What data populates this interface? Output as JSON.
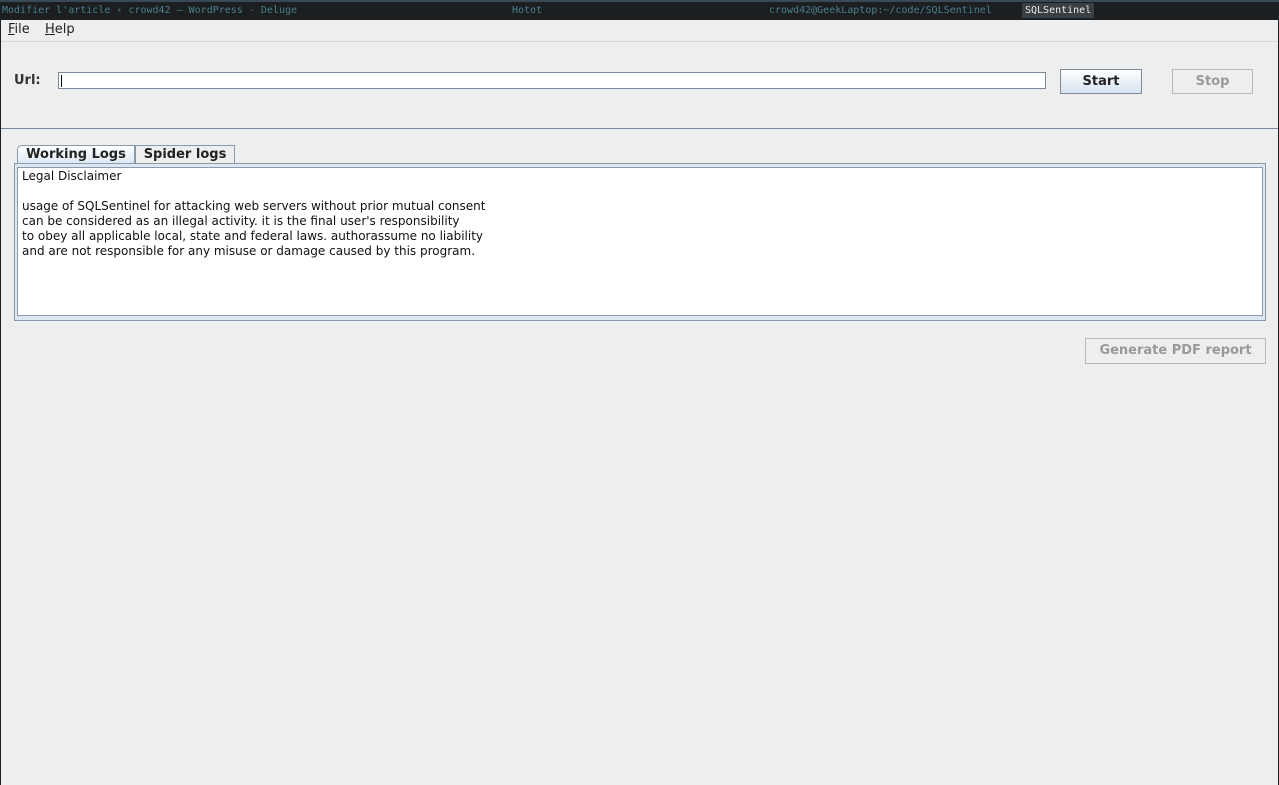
{
  "taskbar": {
    "tasks": [
      {
        "label": "Modifier l'article ‹ crowd42 — WordPress - Deluge"
      },
      {
        "label": "Hotot"
      },
      {
        "label": "crowd42@GeekLaptop:~/code/SQLSentinel"
      },
      {
        "label": "SQLSentinel"
      }
    ]
  },
  "menubar": {
    "items": [
      {
        "mnemonic": "F",
        "rest": "ile"
      },
      {
        "mnemonic": "H",
        "rest": "elp"
      }
    ]
  },
  "url_bar": {
    "label": "Url:",
    "value": "",
    "start_label": "Start",
    "stop_label": "Stop"
  },
  "tabs": [
    {
      "label": "Working Logs",
      "active": true
    },
    {
      "label": "Spider logs",
      "active": false
    }
  ],
  "log": {
    "text": "Legal Disclaimer\n\nusage of SQLSentinel for attacking web servers without prior mutual consent\ncan be considered as an illegal activity. it is the final user's responsibility\nto obey all applicable local, state and federal laws. authorassume no liability\nand are not responsible for any misuse or damage caused by this program."
  },
  "report": {
    "button_label": "Generate PDF report"
  },
  "colors": {
    "taskbar_bg": "#1b1f22",
    "window_bg": "#eeeeee",
    "accent_border": "#7a8a99",
    "disabled_text": "#999999"
  }
}
